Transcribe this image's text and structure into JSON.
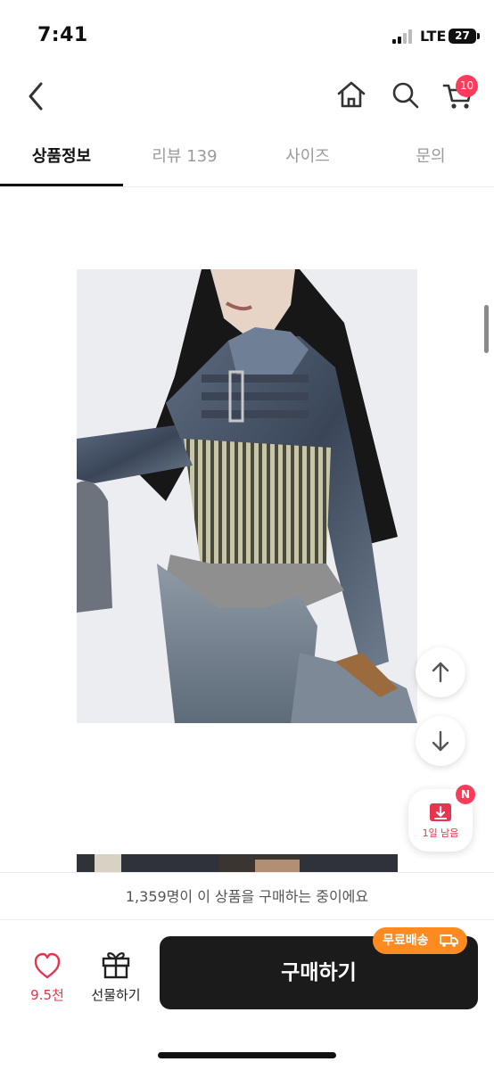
{
  "status_bar": {
    "time": "7:41",
    "carrier": "LTE",
    "battery": "27"
  },
  "header": {
    "cart_count": "10"
  },
  "tabs": [
    {
      "label": "상품정보",
      "active": true
    },
    {
      "label": "리뷰 139",
      "active": false
    },
    {
      "label": "사이즈",
      "active": false
    },
    {
      "label": "문의",
      "active": false
    }
  ],
  "floating": {
    "coupon_text": "1일 남음",
    "coupon_badge": "N"
  },
  "notice": "1,359명이 이 상품을 구매하는 중이에요",
  "bottom_bar": {
    "like_count": "9.5천",
    "gift_label": "선물하기",
    "buy_label": "구매하기",
    "shipping_badge": "무료배송"
  },
  "colors": {
    "accent": "#ff3b5c",
    "shipping_orange": "#ff8a1f",
    "buy_button": "#1b1b1b"
  }
}
